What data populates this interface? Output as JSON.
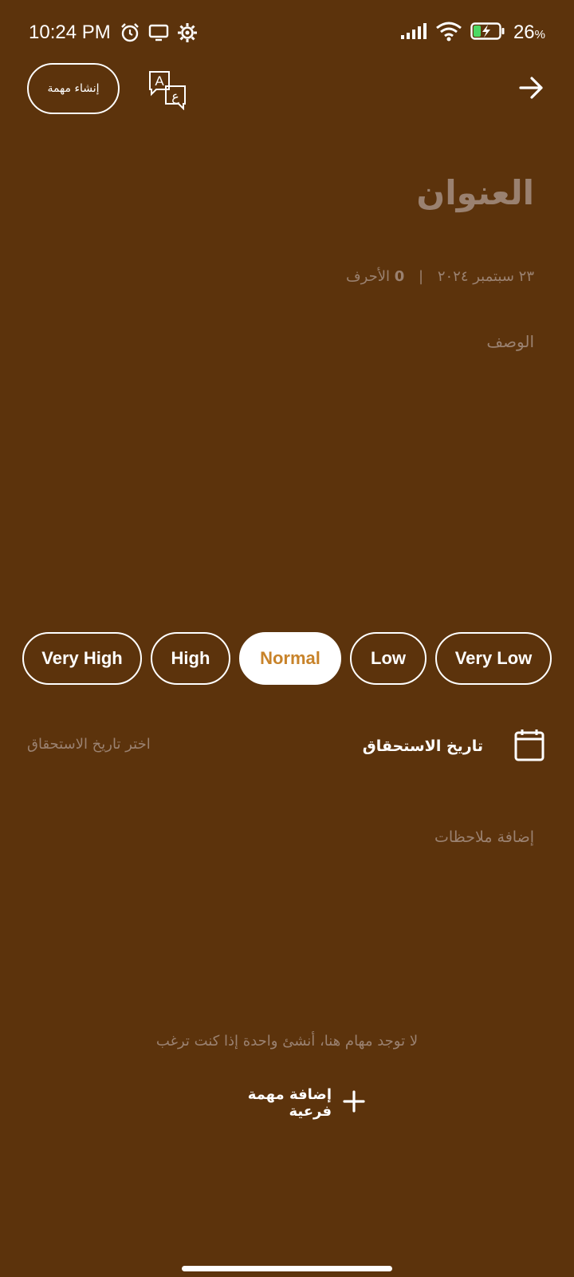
{
  "status_bar": {
    "time": "10:24 PM",
    "battery_percent": "26",
    "battery_unit": "%",
    "icons_left": [
      "alarm-icon",
      "screen-cast-icon",
      "settings-gear-icon"
    ],
    "icons_right": [
      "signal-icon",
      "wifi-icon",
      "battery-charging-icon"
    ]
  },
  "top_bar": {
    "create_task_label": "إنشاء مهمة",
    "translate_icon": "translate-icon",
    "back_icon": "arrow-right-icon"
  },
  "task": {
    "title_placeholder": "العنوان",
    "date": "٢٣ سبتمبر ٢٠٢٤",
    "separator": "|",
    "char_count": "0",
    "char_unit": "الأحرف",
    "description_placeholder": "الوصف"
  },
  "priority": {
    "options": [
      "Very High",
      "High",
      "Normal",
      "Low",
      "Very Low"
    ],
    "selected": "Normal",
    "selected_color": "#c8832a"
  },
  "due_date": {
    "label": "تاريخ الاستحقاق",
    "placeholder": "اختر تاريخ الاستحقاق",
    "icon": "calendar-icon"
  },
  "notes": {
    "placeholder": "إضافة ملاحظات"
  },
  "subtasks": {
    "empty_message": "لا توجد مهام هنا، أنشئ واحدة إذا كنت ترغب",
    "add_label": "إضافة مهمة فرعية",
    "add_icon": "plus-icon"
  },
  "theme": {
    "background": "#5c330c",
    "muted_text": "#9a8170"
  }
}
